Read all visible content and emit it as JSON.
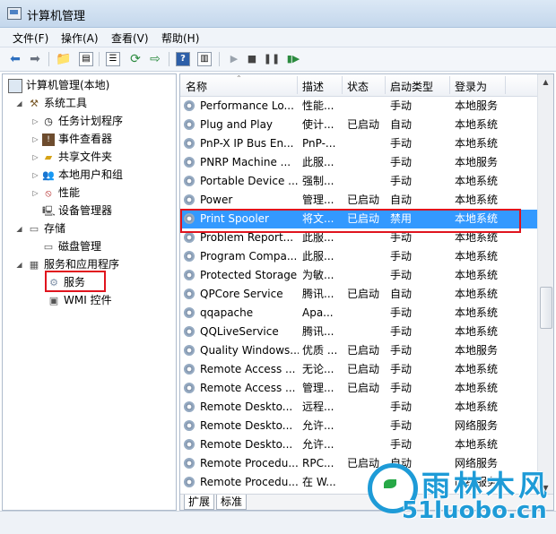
{
  "window": {
    "title": "计算机管理"
  },
  "menu": [
    "文件(F)",
    "操作(A)",
    "查看(V)",
    "帮助(H)"
  ],
  "toolbar": {
    "icons": [
      "back-icon",
      "forward-icon",
      "up-folder-icon",
      "show-hide-tree-icon",
      "properties-icon",
      "refresh-icon",
      "export-list-icon",
      "help-icon",
      "show-hide-action-pane-icon",
      "start-service-icon",
      "stop-service-icon",
      "pause-service-icon",
      "resume-service-icon"
    ]
  },
  "tree": {
    "root": "计算机管理(本地)",
    "system_tools": "系统工具",
    "task_scheduler": "任务计划程序",
    "event_viewer": "事件查看器",
    "shared_folders": "共享文件夹",
    "local_users": "本地用户和组",
    "performance": "性能",
    "device_manager": "设备管理器",
    "storage": "存储",
    "disk_mgmt": "磁盘管理",
    "services_apps": "服务和应用程序",
    "services": "服务",
    "wmi": "WMI 控件"
  },
  "table": {
    "columns": [
      "名称",
      "描述",
      "状态",
      "启动类型",
      "登录为"
    ],
    "rows": [
      [
        "Performance Lo...",
        "性能...",
        "",
        "手动",
        "本地服务"
      ],
      [
        "Plug and Play",
        "使计...",
        "已启动",
        "自动",
        "本地系统"
      ],
      [
        "PnP-X IP Bus En...",
        "PnP-...",
        "",
        "手动",
        "本地系统"
      ],
      [
        "PNRP Machine ...",
        "此服...",
        "",
        "手动",
        "本地服务"
      ],
      [
        "Portable Device ...",
        "强制...",
        "",
        "手动",
        "本地系统"
      ],
      [
        "Power",
        "管理...",
        "已启动",
        "自动",
        "本地系统"
      ],
      [
        "Print Spooler",
        "将文...",
        "已启动",
        "禁用",
        "本地系统"
      ],
      [
        "Problem Report...",
        "此服...",
        "",
        "手动",
        "本地系统"
      ],
      [
        "Program Compa...",
        "此服...",
        "",
        "手动",
        "本地系统"
      ],
      [
        "Protected Storage",
        "为敏...",
        "",
        "手动",
        "本地系统"
      ],
      [
        "QPCore Service",
        "腾讯...",
        "已启动",
        "自动",
        "本地系统"
      ],
      [
        "qqapache",
        "Apa...",
        "",
        "手动",
        "本地系统"
      ],
      [
        "QQLiveService",
        "腾讯...",
        "",
        "手动",
        "本地系统"
      ],
      [
        "Quality Windows...",
        "优质 ...",
        "已启动",
        "手动",
        "本地服务"
      ],
      [
        "Remote Access ...",
        "无论...",
        "已启动",
        "手动",
        "本地系统"
      ],
      [
        "Remote Access ...",
        "管理...",
        "已启动",
        "手动",
        "本地系统"
      ],
      [
        "Remote Deskto...",
        "远程...",
        "",
        "手动",
        "本地系统"
      ],
      [
        "Remote Deskto...",
        "允许...",
        "",
        "手动",
        "网络服务"
      ],
      [
        "Remote Deskto...",
        "允许...",
        "",
        "手动",
        "本地系统"
      ],
      [
        "Remote Procedu...",
        "RPC...",
        "已启动",
        "自动",
        "网络服务"
      ],
      [
        "Remote Procedu...",
        "在 W...",
        "",
        "手动",
        "网络服务"
      ]
    ],
    "selected_index": 6
  },
  "tabs": [
    "扩展",
    "标准"
  ],
  "watermark": {
    "brand": "雨林木风",
    "site": "51luobo.cn"
  }
}
